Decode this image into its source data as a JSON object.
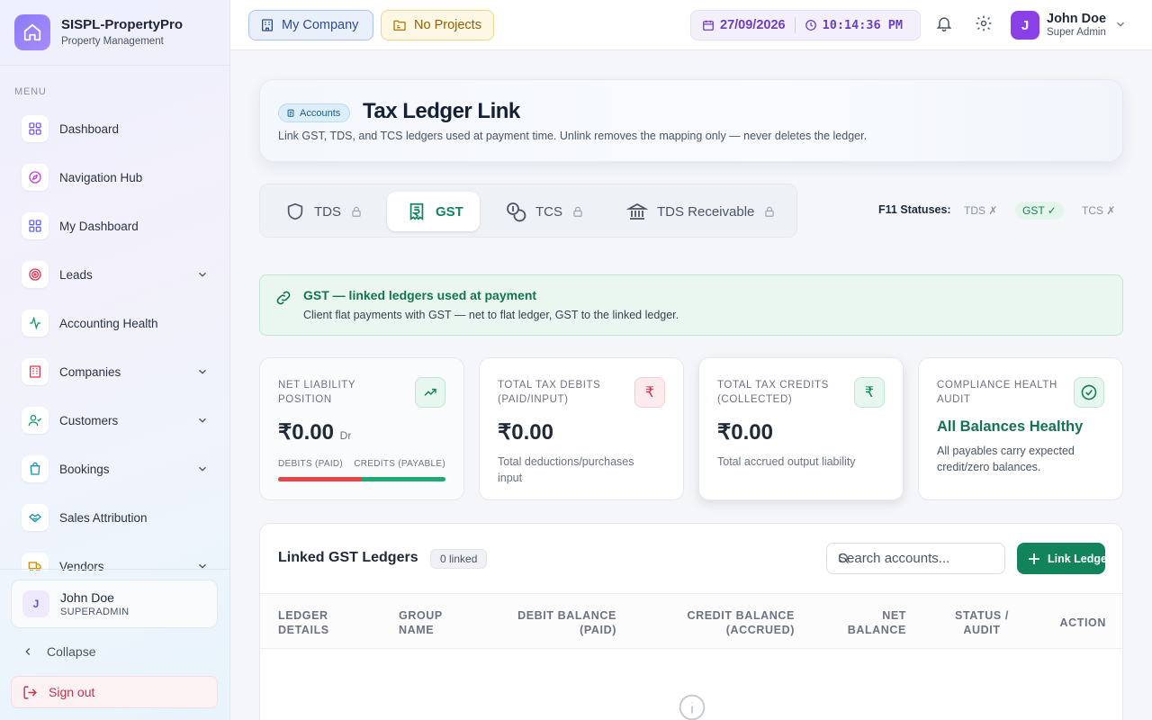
{
  "sidebar": {
    "brand_title": "SISPL-PropertyPro",
    "brand_subtitle": "Property Management",
    "menu_label": "MENU",
    "items": [
      {
        "label": "Dashboard",
        "icon": "grid-icon",
        "color": "#7c5ce6",
        "expandable": false
      },
      {
        "label": "Navigation Hub",
        "icon": "compass-icon",
        "color": "#c63fd6",
        "expandable": false
      },
      {
        "label": "My Dashboard",
        "icon": "grid-icon",
        "color": "#6366f1",
        "expandable": false
      },
      {
        "label": "Leads",
        "icon": "target-icon",
        "color": "#e0344f",
        "expandable": true
      },
      {
        "label": "Accounting Health",
        "icon": "activity-icon",
        "color": "#159a66",
        "expandable": false
      },
      {
        "label": "Companies",
        "icon": "building-icon",
        "color": "#e0344f",
        "expandable": true
      },
      {
        "label": "Customers",
        "icon": "user-check-icon",
        "color": "#159a66",
        "expandable": true
      },
      {
        "label": "Bookings",
        "icon": "shopping-bag-icon",
        "color": "#1790b5",
        "expandable": true
      },
      {
        "label": "Sales Attribution",
        "icon": "handshake-icon",
        "color": "#1690a8",
        "expandable": false
      },
      {
        "label": "Vendors",
        "icon": "truck-icon",
        "color": "#d68a0c",
        "expandable": true
      }
    ],
    "user": {
      "initial": "J",
      "name": "John Doe",
      "role": "SUPERADMIN"
    },
    "collapse_label": "Collapse",
    "signout_label": "Sign out"
  },
  "header": {
    "company_label": "My Company",
    "projects_label": "No Projects",
    "date": "27/09/2026",
    "time": "10:14:36 PM",
    "user_initial": "J",
    "user_name": "John Doe",
    "user_role": "Super Admin"
  },
  "page": {
    "badge": "Accounts",
    "title": "Tax Ledger Link",
    "subtitle": "Link GST, TDS, and TCS ledgers used at payment time. Unlink removes the mapping only — never deletes the ledger."
  },
  "tabs": [
    {
      "label": "TDS",
      "icon": "shield-icon",
      "locked": true,
      "active": false
    },
    {
      "label": "GST",
      "icon": "receipt-rupee-icon",
      "locked": false,
      "active": true
    },
    {
      "label": "TCS",
      "icon": "coins-icon",
      "locked": true,
      "active": false
    },
    {
      "label": "TDS Receivable",
      "icon": "bank-icon",
      "locked": true,
      "active": false
    }
  ],
  "f11": {
    "label": "F11 Statuses:",
    "items": [
      "TDS ✗",
      "GST ✓",
      "TCS ✗"
    ]
  },
  "info_banner": {
    "title": "GST — linked ledgers used at payment",
    "text": "Client flat payments with GST — net to flat ledger, GST to the linked ledger."
  },
  "stats": {
    "net": {
      "label": "NET LIABILITY POSITION",
      "value": "₹0.00",
      "suffix": "Dr",
      "bar_left_label": "DEBITS (PAID)",
      "bar_right_label": "CREDITS (PAYABLE)",
      "debit_share": 0.5
    },
    "debits": {
      "label": "TOTAL TAX DEBITS (PAID/INPUT)",
      "value": "₹0.00",
      "sub": "Total deductions/purchases input"
    },
    "credits": {
      "label": "TOTAL TAX CREDITS (COLLECTED)",
      "value": "₹0.00",
      "sub": "Total accrued output liability"
    },
    "audit": {
      "label": "COMPLIANCE HEALTH AUDIT",
      "value": "All Balances Healthy",
      "sub": "All payables carry expected credit/zero balances."
    }
  },
  "table": {
    "title": "Linked GST Ledgers",
    "count": "0 linked",
    "search_placeholder": "Search accounts...",
    "link_button": "Link Ledger",
    "columns": [
      "LEDGER DETAILS",
      "GROUP NAME",
      "DEBIT BALANCE (PAID)",
      "CREDIT BALANCE (ACCRUED)",
      "NET BALANCE",
      "STATUS / AUDIT",
      "ACTION"
    ]
  }
}
